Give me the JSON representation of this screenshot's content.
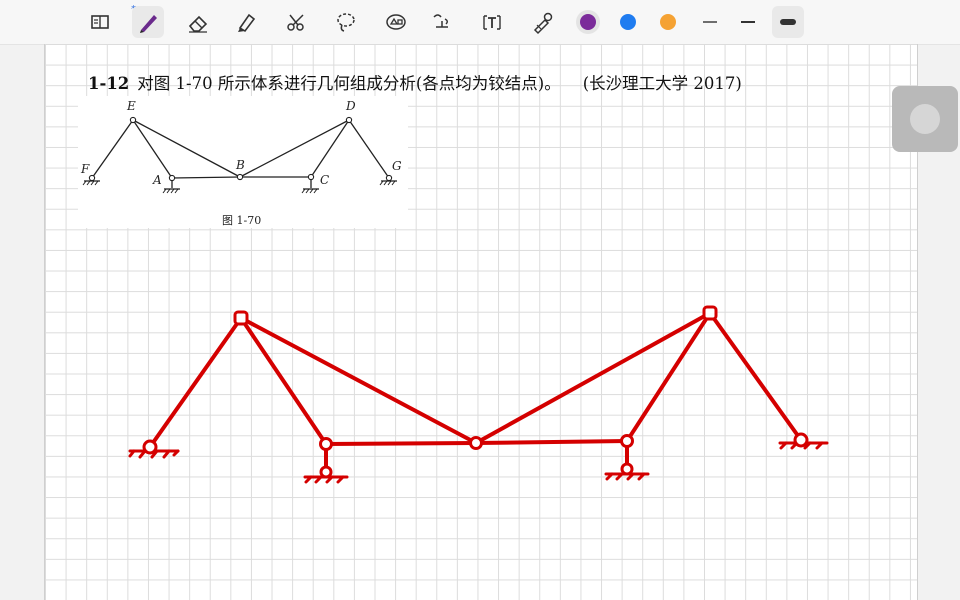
{
  "toolbar": {
    "tools": [
      "layout-icon",
      "pen-icon",
      "eraser-icon",
      "highlighter-icon",
      "scissors-icon",
      "lasso-icon",
      "shapes-icon",
      "text-icon",
      "ruler-icon",
      "color-picker-icon",
      "line-thin-icon",
      "line-medium-icon",
      "line-thick-icon"
    ],
    "bluetooth_mark": "*",
    "colors": [
      "#7b2b9a",
      "#1f7cf0",
      "#f5a233"
    ]
  },
  "problem": {
    "number": "1-12",
    "text": "对图 1-70 所示体系进行几何组成分析(各点均为铰结点)。",
    "source": "(长沙理工大学 2017)"
  },
  "figure": {
    "caption": "图 1-70",
    "labels": {
      "E": "E",
      "D": "D",
      "F": "F",
      "A": "A",
      "B": "B",
      "C": "C",
      "G": "G"
    }
  },
  "sketch": {
    "color": "#d40000"
  }
}
